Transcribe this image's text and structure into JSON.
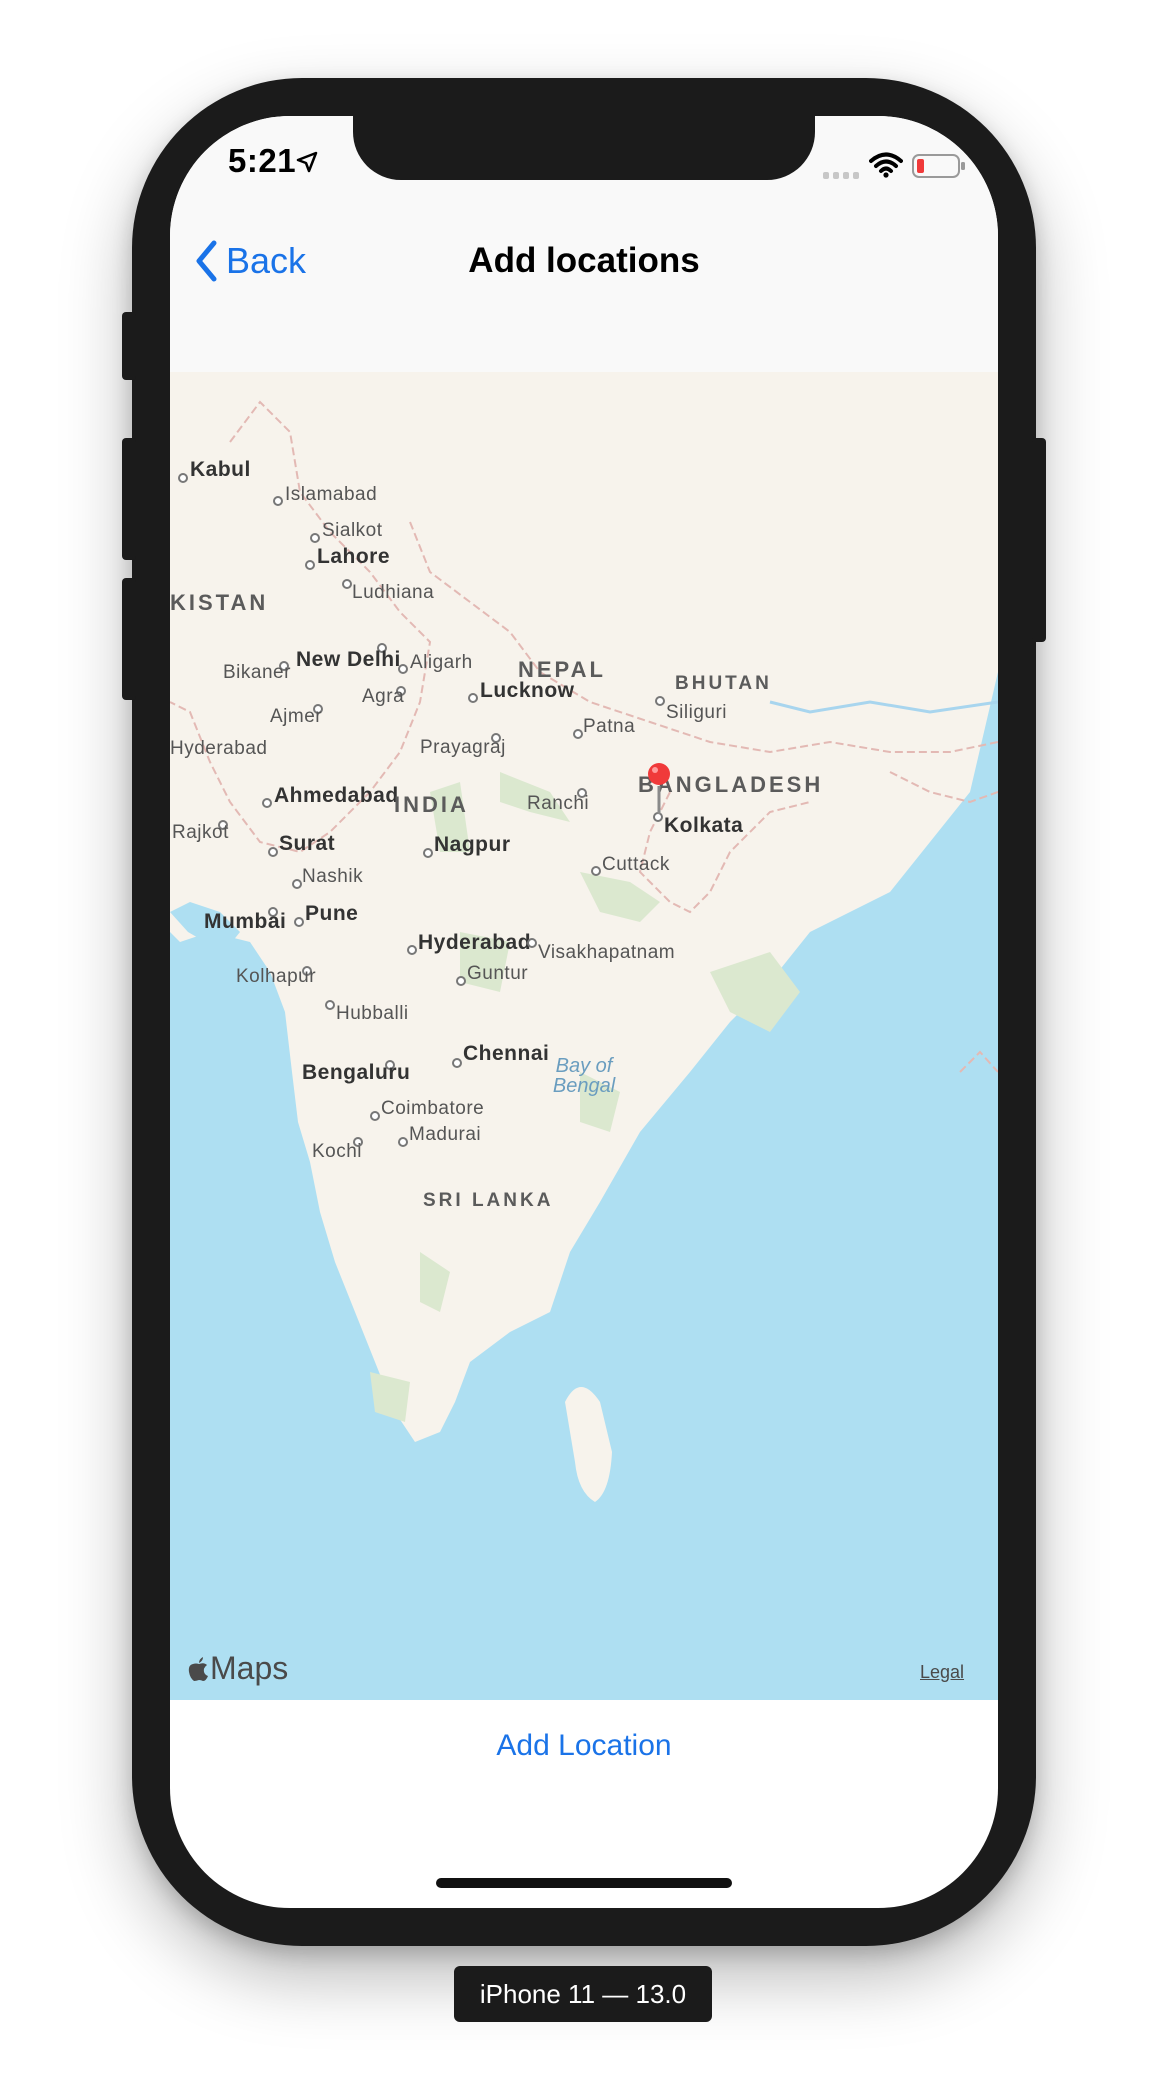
{
  "status_bar": {
    "time": "5:21"
  },
  "nav": {
    "back_label": "Back",
    "title": "Add locations"
  },
  "map": {
    "countries": {
      "pakistan": "KISTAN",
      "nepal": "NEPAL",
      "bhutan": "BHUTAN",
      "india": "INDIA",
      "bangladesh": "BANGLADESH",
      "sri_lanka": "SRI LANKA"
    },
    "cities": {
      "kabul": "Kabul",
      "islamabad": "Islamabad",
      "sialkot": "Sialkot",
      "lahore": "Lahore",
      "ludhiana": "Ludhiana",
      "new_delhi": "New Delhi",
      "aligarh": "Aligarh",
      "bikaner": "Bikaner",
      "agra": "Agra",
      "lucknow": "Lucknow",
      "ajmer": "Ajmer",
      "siliguri": "Siliguri",
      "patna": "Patna",
      "hyderabad_pk": "Hyderabad",
      "prayagraj": "Prayagraj",
      "ahmedabad": "Ahmedabad",
      "ranchi": "Ranchi",
      "kolkata": "Kolkata",
      "rajkot": "Rajkot",
      "surat": "Surat",
      "nagpur": "Nagpur",
      "cuttack": "Cuttack",
      "nashik": "Nashik",
      "mumbai": "Mumbai",
      "pune": "Pune",
      "hyderabad": "Hyderabad",
      "visakhapatnam": "Visakhapatnam",
      "kolhapur": "Kolhapur",
      "guntur": "Guntur",
      "hubballi": "Hubballi",
      "chennai": "Chennai",
      "bengaluru": "Bengaluru",
      "coimbatore": "Coimbatore",
      "madurai": "Madurai",
      "kochi": "Kochi"
    },
    "water": {
      "bay_of_bengal_1": "Bay of",
      "bay_of_bengal_2": "Bengal"
    },
    "logo_text": "Maps",
    "legal": "Legal"
  },
  "actions": {
    "add_location": "Add Location"
  },
  "device_label": "iPhone 11 — 13.0",
  "colors": {
    "accent": "#1a73e8",
    "land": "#f7f3ec",
    "water": "#aedff2",
    "pin": "#f03a3a"
  }
}
